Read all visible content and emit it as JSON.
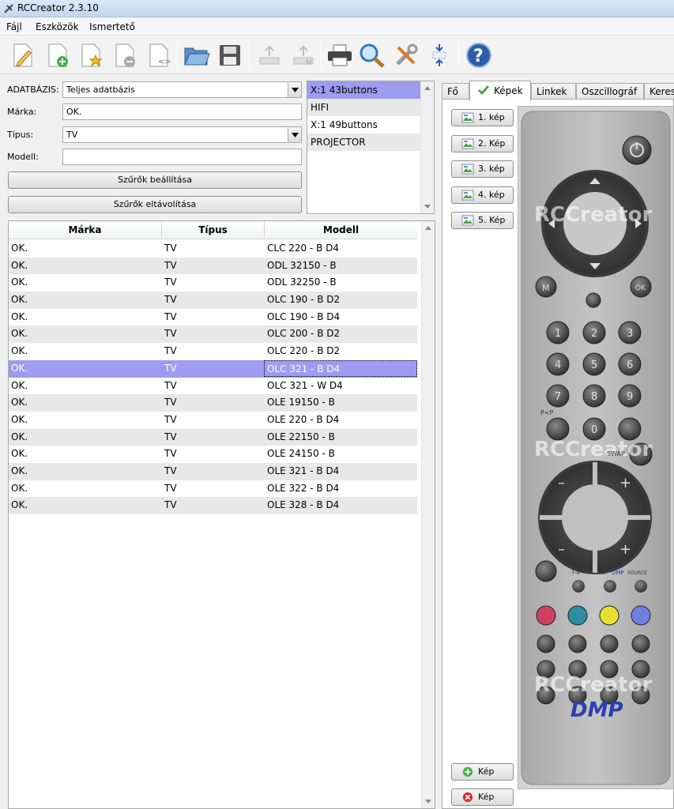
{
  "window": {
    "title": "RCCreator 2.3.10"
  },
  "menu": [
    "Fájl",
    "Eszközök",
    "Ismertető"
  ],
  "toolbar_icons": [
    "new-document-icon",
    "add-document-icon",
    "favorite-document-icon",
    "remove-document-icon",
    "code-document-icon",
    "open-folder-icon",
    "save-disk-icon",
    "upload-icon",
    "m-upload-icon",
    "printer-icon",
    "magnifier-icon",
    "tools-icon",
    "resize-icon",
    "help-icon"
  ],
  "filters": {
    "db_label": "ADATBÁZIS:",
    "db_value": "Teljes adatbázis",
    "brand_label": "Márka:",
    "brand_value": "OK.",
    "type_label": "Típus:",
    "type_value": "TV",
    "model_label": "Modell:",
    "model_value": "",
    "apply_button": "Szűrők beállítása",
    "clear_button": "Szűrők eltávolítása"
  },
  "db_list": [
    "X:1 43buttons",
    "HIFI",
    "X:1 49buttons",
    "PROJECTOR"
  ],
  "table": {
    "headers": [
      "Márka",
      "Típus",
      "Modell"
    ],
    "selected_index": 7,
    "rows": [
      [
        "OK.",
        "TV",
        "CLC 220 - B D4"
      ],
      [
        "OK.",
        "TV",
        "ODL 32150 - B"
      ],
      [
        "OK.",
        "TV",
        "ODL 32250 - B"
      ],
      [
        "OK.",
        "TV",
        "OLC 190 - B D2"
      ],
      [
        "OK.",
        "TV",
        "OLC 190 - B D4"
      ],
      [
        "OK.",
        "TV",
        "OLC 200 - B D2"
      ],
      [
        "OK.",
        "TV",
        "OLC 220 - B D2"
      ],
      [
        "OK.",
        "TV",
        "OLC 321 - B D4"
      ],
      [
        "OK.",
        "TV",
        "OLC 321 - W D4"
      ],
      [
        "OK.",
        "TV",
        "OLE 19150 - B"
      ],
      [
        "OK.",
        "TV",
        "OLE 220 - B D4"
      ],
      [
        "OK.",
        "TV",
        "OLE 22150 - B"
      ],
      [
        "OK.",
        "TV",
        "OLE 24150 - B"
      ],
      [
        "OK.",
        "TV",
        "OLE 321 - B D4"
      ],
      [
        "OK.",
        "TV",
        "OLE 322 - B D4"
      ],
      [
        "OK.",
        "TV",
        "OLE 328 - B D4"
      ]
    ]
  },
  "tabs": [
    "Fő",
    "Képek",
    "Linkek",
    "Oszcillográf",
    "Keres"
  ],
  "active_tab": "Képek",
  "image_buttons": [
    "1. kép",
    "2. Kép",
    "3. kép",
    "4. kép",
    "5. Kép"
  ],
  "add_image_button": "Kép",
  "delete_image_button": "Kép",
  "remote": {
    "watermark": "RCCreator",
    "brand": "DMP",
    "labels": {
      "m": "M",
      "ok": "OK",
      "pp": "P<P",
      "swap": "SWAP",
      "i_ii": "I-II",
      "tv": "TV",
      "dmp_small": "DMP",
      "source": "SOURCE"
    },
    "digits": [
      "1",
      "2",
      "3",
      "4",
      "5",
      "6",
      "7",
      "8",
      "9",
      "0"
    ]
  },
  "colors": {
    "selection": "#9c9cf0",
    "accent_green": "#3aa13a",
    "red_btn": "#d04060",
    "teal_btn": "#2a8fa0",
    "yellow_btn": "#e8e030",
    "blue_btn": "#7080e0"
  }
}
